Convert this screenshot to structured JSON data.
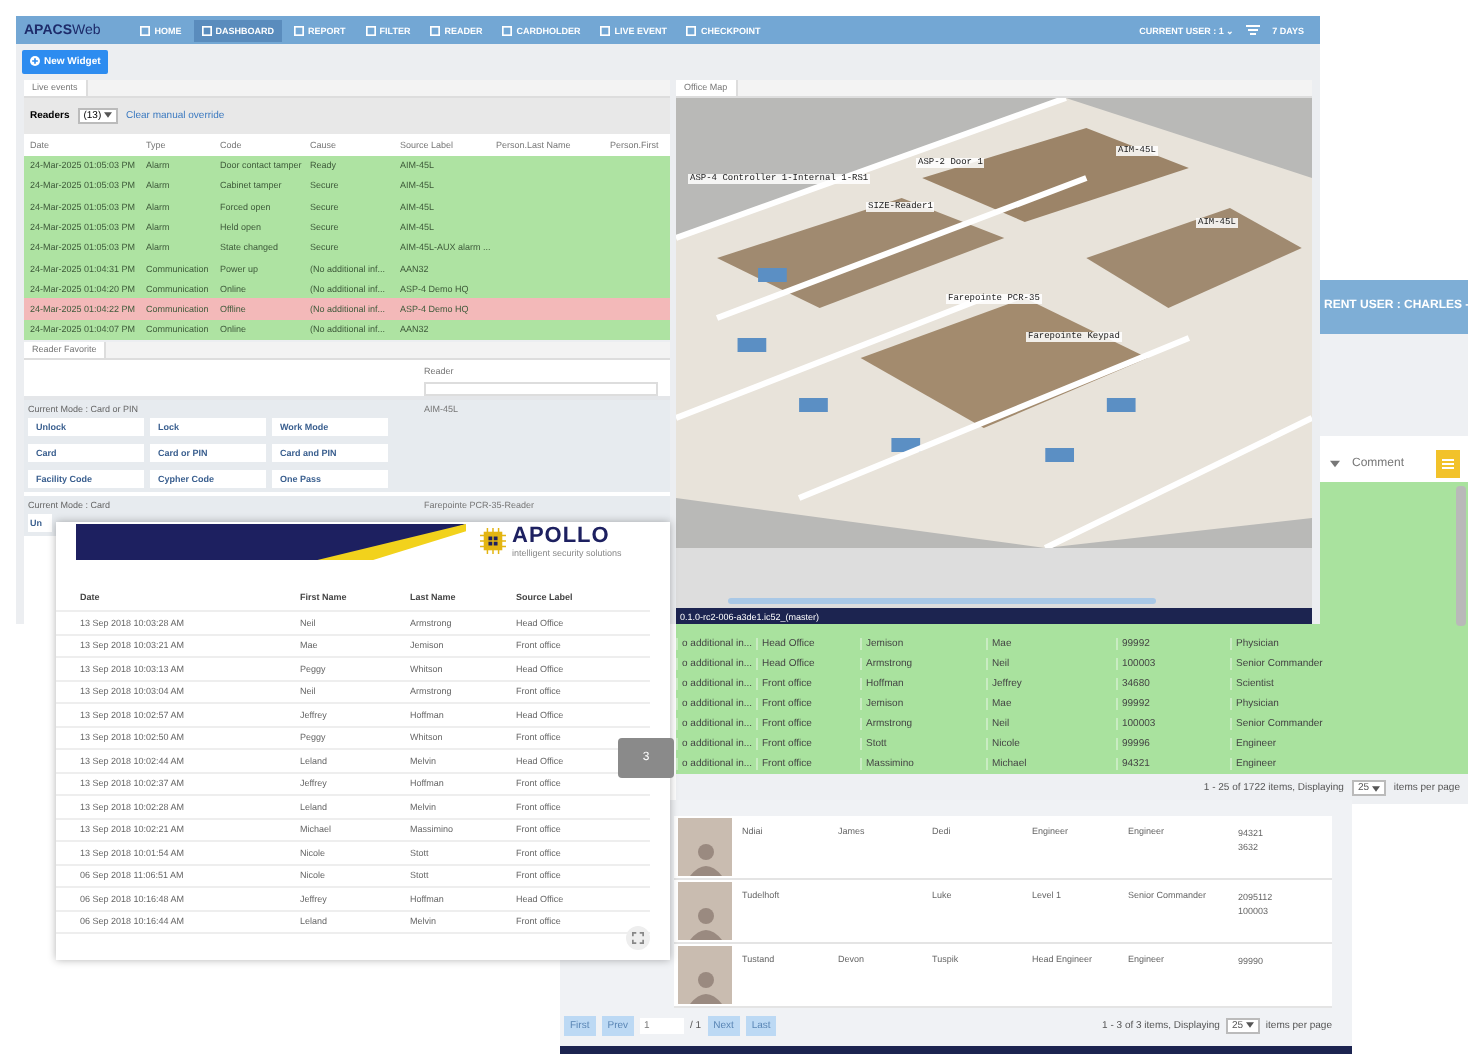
{
  "nav": {
    "logo_bold": "APACS",
    "logo_light": "Web",
    "items": [
      {
        "label": "HOME",
        "selected": false
      },
      {
        "label": "DASHBOARD",
        "selected": true
      },
      {
        "label": "REPORT",
        "selected": false
      },
      {
        "label": "FILTER",
        "selected": false
      },
      {
        "label": "READER",
        "selected": false
      },
      {
        "label": "CARDHOLDER",
        "selected": false
      },
      {
        "label": "LIVE EVENT",
        "selected": false
      },
      {
        "label": "CHECKPOINT",
        "selected": false
      }
    ],
    "current_user": "CURRENT USER : 1 ⌄",
    "period": "7 DAYS"
  },
  "toolbar": {
    "new_widget": "New Widget"
  },
  "live_events": {
    "tab": "Live events",
    "readers_label": "Readers",
    "readers_value": "(13)",
    "clear_link": "Clear manual override",
    "columns": [
      "Date",
      "Type",
      "Code",
      "Cause",
      "Source Label",
      "Person.Last Name",
      "Person.First"
    ],
    "rows": [
      {
        "color": "#aee3a2",
        "cells": [
          "24-Mar-2025 01:05:03 PM",
          "Alarm",
          "Door contact tamper",
          "Ready",
          "AIM-45L"
        ]
      },
      {
        "color": "#aee3a2",
        "cells": [
          "24-Mar-2025 01:05:03 PM",
          "Alarm",
          "Cabinet tamper",
          "Secure",
          "AIM-45L"
        ]
      },
      {
        "color": "#aee3a2",
        "cells": [
          "24-Mar-2025 01:05:03 PM",
          "Alarm",
          "Forced open",
          "Secure",
          "AIM-45L"
        ]
      },
      {
        "color": "#aee3a2",
        "cells": [
          "24-Mar-2025 01:05:03 PM",
          "Alarm",
          "Held open",
          "Secure",
          "AIM-45L"
        ]
      },
      {
        "color": "#aee3a2",
        "cells": [
          "24-Mar-2025 01:05:03 PM",
          "Alarm",
          "State changed",
          "Secure",
          "AIM-45L-AUX alarm ..."
        ]
      },
      {
        "color": "#aee3a2",
        "cells": [
          "24-Mar-2025 01:04:31 PM",
          "Communication",
          "Power up",
          "(No additional inf...",
          "AAN32"
        ]
      },
      {
        "color": "#aee3a2",
        "cells": [
          "24-Mar-2025 01:04:20 PM",
          "Communication",
          "Online",
          "(No additional inf...",
          "ASP-4 Demo HQ"
        ]
      },
      {
        "color": "#f3b9b9",
        "cells": [
          "24-Mar-2025 01:04:22 PM",
          "Communication",
          "Offline",
          "(No additional inf...",
          "ASP-4 Demo HQ"
        ]
      },
      {
        "color": "#aee3a2",
        "cells": [
          "24-Mar-2025 01:04:07 PM",
          "Communication",
          "Online",
          "(No additional inf...",
          "AAN32"
        ]
      }
    ]
  },
  "reader_favorite": {
    "tab": "Reader Favorite",
    "reader_label": "Reader",
    "groups": [
      {
        "mode": "Current Mode : Card or PIN",
        "reader": "AIM-45L",
        "buttons": [
          "Unlock",
          "Lock",
          "Work Mode",
          "Card",
          "Card or PIN",
          "Card and PIN",
          "Facility Code",
          "Cypher Code",
          "One Pass"
        ]
      },
      {
        "mode": "Current Mode : Card",
        "reader": "Farepointe PCR-35-Reader",
        "buttons": [
          "Un"
        ]
      }
    ]
  },
  "office_map": {
    "tab": "Office Map",
    "labels": [
      "ASP-4 Controller 1-Internal 1-RS1",
      "ASP-2 Door 1",
      "SIZE-Reader1",
      "AIM-45L",
      "Farepointe PCR-35",
      "Farepointe Keypad",
      "AIM-45L"
    ],
    "status": "0.1.0-rc2-006-a3de1.ic52_(master)"
  },
  "people_window": {
    "user": "RENT USER : CHARLES -",
    "comment_column": "Comment",
    "rows": [
      [
        "o additional in...",
        "Head Office",
        "Jemison",
        "Mae",
        "99992",
        "Physician"
      ],
      [
        "o additional in...",
        "Head Office",
        "Armstrong",
        "Neil",
        "100003",
        "Senior Commander"
      ],
      [
        "o additional in...",
        "Front office",
        "Hoffman",
        "Jeffrey",
        "34680",
        "Scientist"
      ],
      [
        "o additional in...",
        "Front office",
        "Jemison",
        "Mae",
        "99992",
        "Physician"
      ],
      [
        "o additional in...",
        "Front office",
        "Armstrong",
        "Neil",
        "100003",
        "Senior Commander"
      ],
      [
        "o additional in...",
        "Front office",
        "Stott",
        "Nicole",
        "99996",
        "Engineer"
      ],
      [
        "o additional in...",
        "Front office",
        "Massimino",
        "Michael",
        "94321",
        "Engineer"
      ]
    ],
    "pager_text": "1 - 25 of 1722 items, Displaying",
    "page_size": "25",
    "per_page": "items per page"
  },
  "cardholders": {
    "rows": [
      {
        "cells": [
          "Ndiai",
          "James",
          "Dedi",
          "Engineer",
          "Engineer"
        ],
        "cards": [
          "94321",
          "3632"
        ]
      },
      {
        "cells": [
          "Tudelhoft",
          "",
          "Luke",
          "Level 1",
          "Senior Commander"
        ],
        "cards": [
          "2095112",
          "100003"
        ]
      },
      {
        "cells": [
          "Tustand",
          "Devon",
          "Tuspik",
          "Head Engineer",
          "Engineer"
        ],
        "cards": [
          "99990"
        ]
      }
    ],
    "pager": {
      "first": "First",
      "prev": "Prev",
      "page": "1",
      "total": "/ 1",
      "next": "Next",
      "last": "Last",
      "summary": "1 - 3 of 3 items, Displaying",
      "page_size": "25",
      "per_page": "items per page"
    }
  },
  "report": {
    "logo": "APOLLO",
    "tagline": "intelligent security solutions",
    "columns": [
      "Date",
      "First Name",
      "Last Name",
      "Source Label"
    ],
    "rows": [
      [
        "13 Sep 2018 10:03:28 AM",
        "Neil",
        "Armstrong",
        "Head Office"
      ],
      [
        "13 Sep 2018 10:03:21 AM",
        "Mae",
        "Jemison",
        "Front office"
      ],
      [
        "13 Sep 2018 10:03:13 AM",
        "Peggy",
        "Whitson",
        "Head Office"
      ],
      [
        "13 Sep 2018 10:03:04 AM",
        "Neil",
        "Armstrong",
        "Front office"
      ],
      [
        "13 Sep 2018 10:02:57 AM",
        "Jeffrey",
        "Hoffman",
        "Head Office"
      ],
      [
        "13 Sep 2018 10:02:50 AM",
        "Peggy",
        "Whitson",
        "Front office"
      ],
      [
        "13 Sep 2018 10:02:44 AM",
        "Leland",
        "Melvin",
        "Head Office"
      ],
      [
        "13 Sep 2018 10:02:37 AM",
        "Jeffrey",
        "Hoffman",
        "Front office"
      ],
      [
        "13 Sep 2018 10:02:28 AM",
        "Leland",
        "Melvin",
        "Front office"
      ],
      [
        "13 Sep 2018 10:02:21 AM",
        "Michael",
        "Massimino",
        "Front office"
      ],
      [
        "13 Sep 2018 10:01:54 AM",
        "Nicole",
        "Stott",
        "Front office"
      ],
      [
        "06 Sep 2018 11:06:51 AM",
        "Nicole",
        "Stott",
        "Front office"
      ],
      [
        "06 Sep 2018 10:16:48 AM",
        "Jeffrey",
        "Hoffman",
        "Head Office"
      ],
      [
        "06 Sep 2018 10:16:44 AM",
        "Leland",
        "Melvin",
        "Front office"
      ]
    ]
  },
  "page_badge": "3"
}
